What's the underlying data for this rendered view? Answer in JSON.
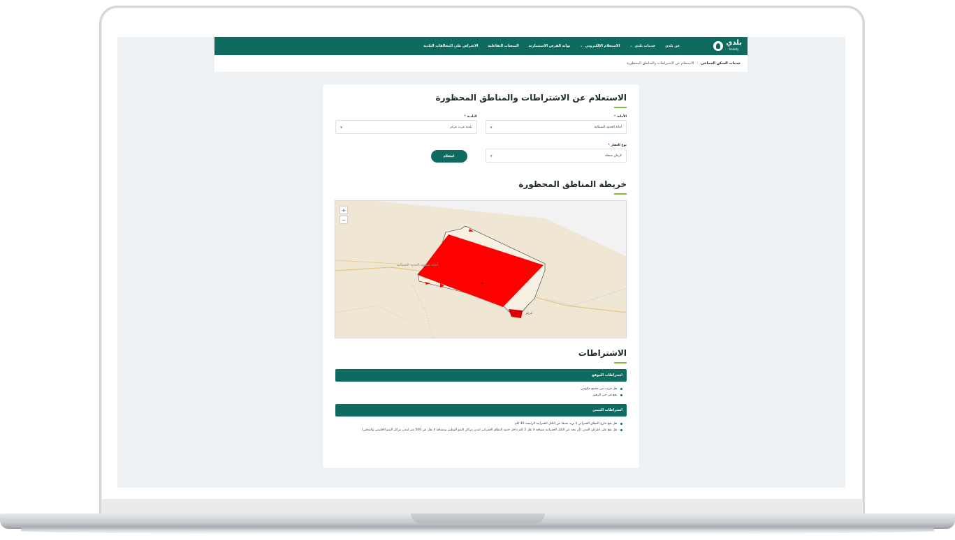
{
  "navbar": {
    "logo": {
      "text": "بلدي",
      "sub": "balady"
    },
    "items": [
      {
        "label": "عن بلدي",
        "has_dropdown": false
      },
      {
        "label": "خدمات بلدي",
        "has_dropdown": true
      },
      {
        "label": "الاستعلام الإلكتروني",
        "has_dropdown": true
      },
      {
        "label": "بوابة الفرص الاستثمارية",
        "has_dropdown": false
      },
      {
        "label": "المنصات التفاعلية",
        "has_dropdown": false
      },
      {
        "label": "الاعتراض على المخالفات البلدية",
        "has_dropdown": false
      }
    ]
  },
  "breadcrumb": {
    "root": "خدمات السكن الجماعي",
    "separator": "/",
    "current": "الاستعلام عن الاشتراطات والمناطق المحظورة"
  },
  "page": {
    "title": "الاستعلام عن الاشتراطات والمناطق المحظورة"
  },
  "form": {
    "amanah": {
      "label": "الأمانة",
      "value": "أمانة الحدود الشمالية"
    },
    "municipality": {
      "label": "البلدية",
      "value": "بلدية عرب عرعر"
    },
    "property_type": {
      "label": "نوع العقار",
      "value": "كرفان متنقلة"
    },
    "submit_label": "استعلام"
  },
  "map": {
    "title": "خريطة المناطق المحظورة",
    "zoom_in": "+",
    "zoom_out": "−",
    "labels": [
      "أمانة منطقة الحدود الشمالية",
      "عرعر"
    ],
    "colors": {
      "restricted": "#ff0000",
      "land": "#efe6d4",
      "outside": "#f2f2f2"
    }
  },
  "conditions": {
    "title": "الاشتراطات",
    "sections": [
      {
        "title": "اشتراطات الموقع",
        "items": [
          "هل قريب من مجمع حكومي",
          "يقع في حي الزهور"
        ]
      },
      {
        "title": "اشتراطات المبنى",
        "items": [
          "هل يقع خارج النطاق العمراني لا يزيد بعدها عن الكتل العمرانية الرئيسة 40 كلم",
          "هل يقع على اطراف المدن (أن تبعد عن الكتل العمرانية مسافة لا تقل 2 كلم داخل حدود النطاق العمراني لمدن مراكز النمو الوطني ومسافة لا تقل عن 500 متر لمدن مراكز النمو الاقليمي والمحلي)"
        ]
      }
    ]
  },
  "theme": {
    "primary": "#0f6b60",
    "accent": "#7cbf3f"
  }
}
